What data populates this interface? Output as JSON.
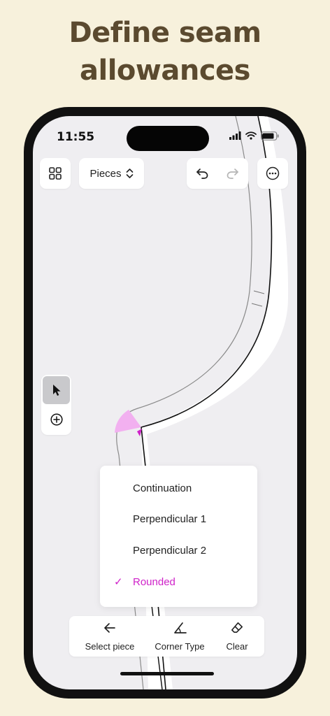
{
  "headline": {
    "line1": "Define seam",
    "line2": "allowances"
  },
  "status_bar": {
    "time": "11:55"
  },
  "toolbar": {
    "grid_icon": "grid-icon",
    "pieces_label": "Pieces",
    "undo_icon": "undo-icon",
    "redo_icon": "redo-icon",
    "more_icon": "more-icon"
  },
  "side_tools": {
    "pointer_icon": "pointer-icon",
    "add_icon": "add-point-icon",
    "pointer_active": true
  },
  "corner_menu": {
    "items": [
      {
        "label": "Continuation",
        "selected": false
      },
      {
        "label": "Perpendicular 1",
        "selected": false
      },
      {
        "label": "Perpendicular 2",
        "selected": false
      },
      {
        "label": "Rounded",
        "selected": true
      }
    ],
    "check_mark": "✓"
  },
  "bottom_bar": {
    "select_piece": "Select piece",
    "corner_type": "Corner Type",
    "clear": "Clear"
  },
  "colors": {
    "accent": "#cf22c9",
    "highlight": "#f2b0f0",
    "background": "#f7f1dc",
    "headline": "#5b4a2f"
  }
}
